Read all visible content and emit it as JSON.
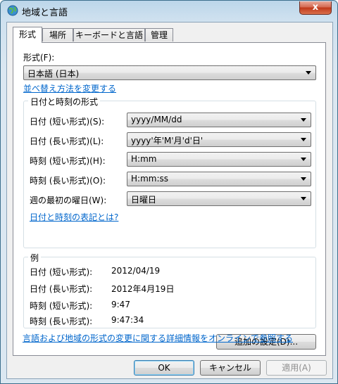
{
  "window": {
    "title": "地域と言語",
    "close_label": "x"
  },
  "tabs": [
    "形式",
    "場所",
    "キーボードと言語",
    "管理"
  ],
  "format": {
    "label": "形式(F):",
    "value": "日本語 (日本)",
    "sort_link": "並べ替え方法を変更する"
  },
  "datetime": {
    "group_title": "日付と時刻の形式",
    "rows": [
      {
        "label": "日付 (短い形式)(S):",
        "value": "yyyy/MM/dd"
      },
      {
        "label": "日付 (長い形式)(L):",
        "value": "yyyy'年'M'月'd'日'"
      },
      {
        "label": "時刻 (短い形式)(H):",
        "value": "H:mm"
      },
      {
        "label": "時刻 (長い形式)(O):",
        "value": "H:mm:ss"
      },
      {
        "label": "週の最初の曜日(W):",
        "value": "日曜日"
      }
    ],
    "notation_link": "日付と時刻の表記とは?"
  },
  "examples": {
    "group_title": "例",
    "rows": [
      {
        "label": "日付 (短い形式):",
        "value": "2012/04/19"
      },
      {
        "label": "日付 (長い形式):",
        "value": "2012年4月19日"
      },
      {
        "label": "時刻 (短い形式):",
        "value": "9:47"
      },
      {
        "label": "時刻 (長い形式):",
        "value": "9:47:34"
      }
    ]
  },
  "additional_button": "追加の設定(D)...",
  "online_link": "言語および地域の形式の変更に関する詳細情報をオンラインで参照する",
  "buttons": {
    "ok": "OK",
    "cancel": "キャンセル",
    "apply": "適用(A)"
  }
}
